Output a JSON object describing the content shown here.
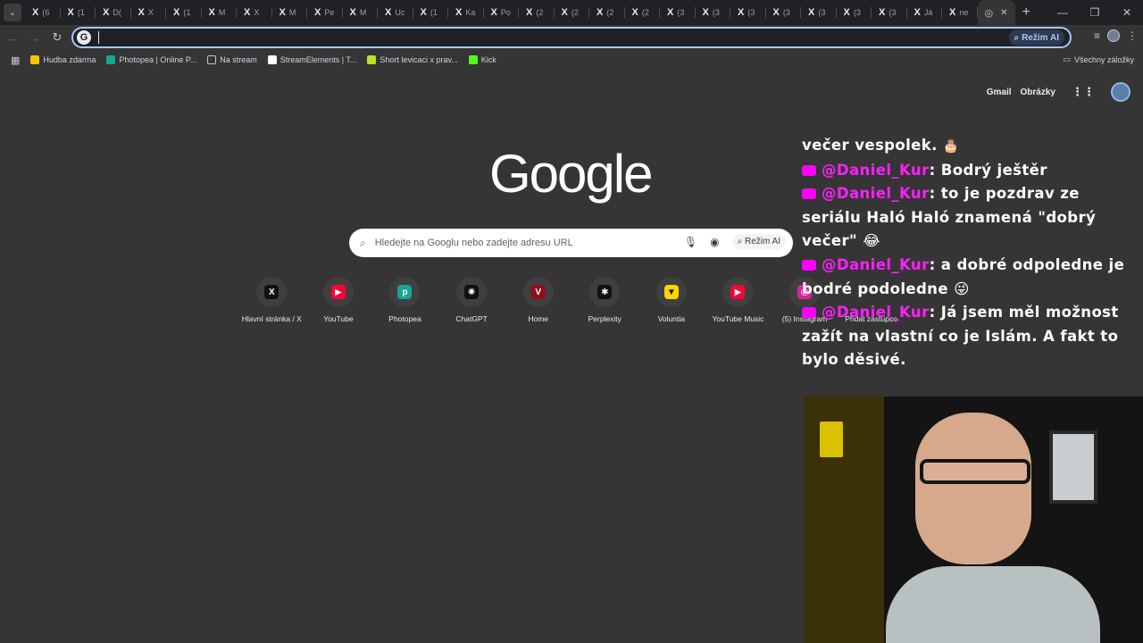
{
  "tabstrip": {
    "tabs": [
      {
        "label": "(6"
      },
      {
        "label": "(1"
      },
      {
        "label": "D("
      },
      {
        "label": "X"
      },
      {
        "label": "(1"
      },
      {
        "label": "M"
      },
      {
        "label": "X"
      },
      {
        "label": "M"
      },
      {
        "label": "Pe"
      },
      {
        "label": "M"
      },
      {
        "label": "Uc"
      },
      {
        "label": "(1"
      },
      {
        "label": "Ka"
      },
      {
        "label": "Po"
      },
      {
        "label": "(2"
      },
      {
        "label": "(2"
      },
      {
        "label": "(2"
      },
      {
        "label": "(2"
      },
      {
        "label": "(3"
      },
      {
        "label": "(3"
      },
      {
        "label": "(3"
      },
      {
        "label": "(3"
      },
      {
        "label": "(3"
      },
      {
        "label": "(3"
      },
      {
        "label": "(3"
      },
      {
        "label": "Já"
      },
      {
        "label": "ne"
      }
    ]
  },
  "omnibox": {
    "value": "",
    "ai_mode_label": "Režim AI"
  },
  "bookmarks": {
    "items": [
      {
        "label": "Hudba zdarma",
        "icon": "warning-triangle-icon",
        "color": "#f5c400"
      },
      {
        "label": "Photopea | Online P...",
        "icon": "photopea-icon",
        "color": "#18a497"
      },
      {
        "label": "Na stream",
        "icon": "folder-icon",
        "color": "#c4c7c5"
      },
      {
        "label": "StreamElements | T...",
        "icon": "streamelements-icon",
        "color": "#ffffff"
      },
      {
        "label": "Short levicaci x prav...",
        "icon": "vimeo-v-icon",
        "color": "#b6e02c"
      },
      {
        "label": "Kick",
        "icon": "kick-icon",
        "color": "#53fc18"
      }
    ],
    "all_bookmarks_label": "Všechny záložky"
  },
  "header": {
    "gmail_label": "Gmail",
    "images_label": "Obrázky"
  },
  "logo": {
    "text": "Google"
  },
  "search": {
    "placeholder": "Hledejte na Googlu nebo zadejte adresu URL",
    "ai_mode_label": "Režim AI"
  },
  "shortcuts": [
    {
      "label": "Hlavní stránka / X",
      "glyph": "X",
      "bg": "#111111",
      "fg": "#ffffff"
    },
    {
      "label": "YouTube",
      "glyph": "▶",
      "bg": "#ff0033",
      "fg": "#ffffff"
    },
    {
      "label": "Photopea",
      "glyph": "p",
      "bg": "#18a497",
      "fg": "#ffffff"
    },
    {
      "label": "ChatGPT",
      "glyph": "✺",
      "bg": "#111111",
      "fg": "#ffffff"
    },
    {
      "label": "Home",
      "glyph": "V",
      "bg": "#8b0f1c",
      "fg": "#ffffff"
    },
    {
      "label": "Perplexity",
      "glyph": "✱",
      "bg": "#111111",
      "fg": "#ffffff"
    },
    {
      "label": "Voluntia",
      "glyph": "▼",
      "bg": "#ffd400",
      "fg": "#111111"
    },
    {
      "label": "YouTube Music",
      "glyph": "▶",
      "bg": "#ff0033",
      "fg": "#ffffff"
    },
    {
      "label": "(5) Instagram",
      "glyph": "◎",
      "bg": "#d6249f",
      "fg": "#ffffff"
    },
    {
      "label": "Přidat zástupce",
      "glyph": "+",
      "bg": "transparent",
      "fg": "#e8eaed"
    }
  ],
  "chat": {
    "partial_line": "večer vespolek.",
    "messages": [
      {
        "user": "@Daniel_Kur",
        "text": "Bodrý ještěr"
      },
      {
        "user": "@Daniel_Kur",
        "text": "to je pozdrav ze seriálu Haló Haló znamená \"dobrý večer\" 😂"
      },
      {
        "user": "@Daniel_Kur",
        "text": "a dobré odpoledne je bodré podoledne 😜"
      },
      {
        "user": "@Daniel_Kur",
        "text": "Já jsem měl možnost zažít na vlastní co je Islám. A fakt to bylo děsivé."
      }
    ]
  }
}
